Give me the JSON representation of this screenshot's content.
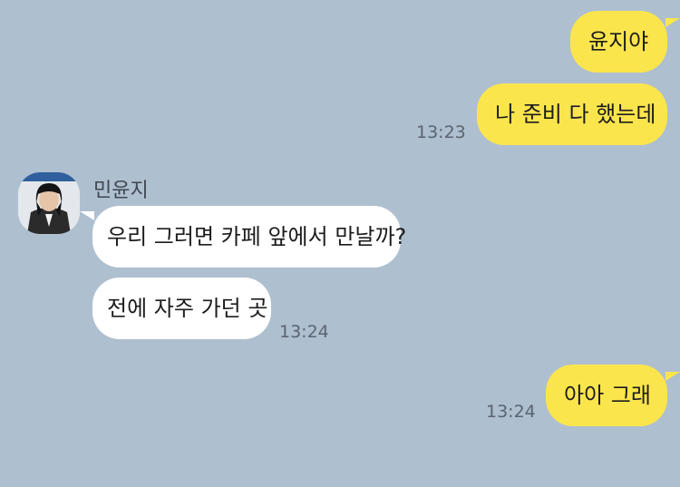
{
  "chat": {
    "sender_name": "민윤지",
    "messages": [
      {
        "from": "me",
        "text": "윤지야"
      },
      {
        "from": "me",
        "text": "나 준비 다 했는데",
        "time": "13:23"
      },
      {
        "from": "other",
        "text": "우리 그러면 카페 앞에서 만날까?"
      },
      {
        "from": "other",
        "text": "전에 자주 가던 곳",
        "time": "13:24"
      },
      {
        "from": "me",
        "text": "아아 그래",
        "time": "13:24"
      }
    ]
  },
  "colors": {
    "background": "#aebfd0",
    "my_bubble": "#fbe54d",
    "other_bubble": "#ffffff"
  }
}
